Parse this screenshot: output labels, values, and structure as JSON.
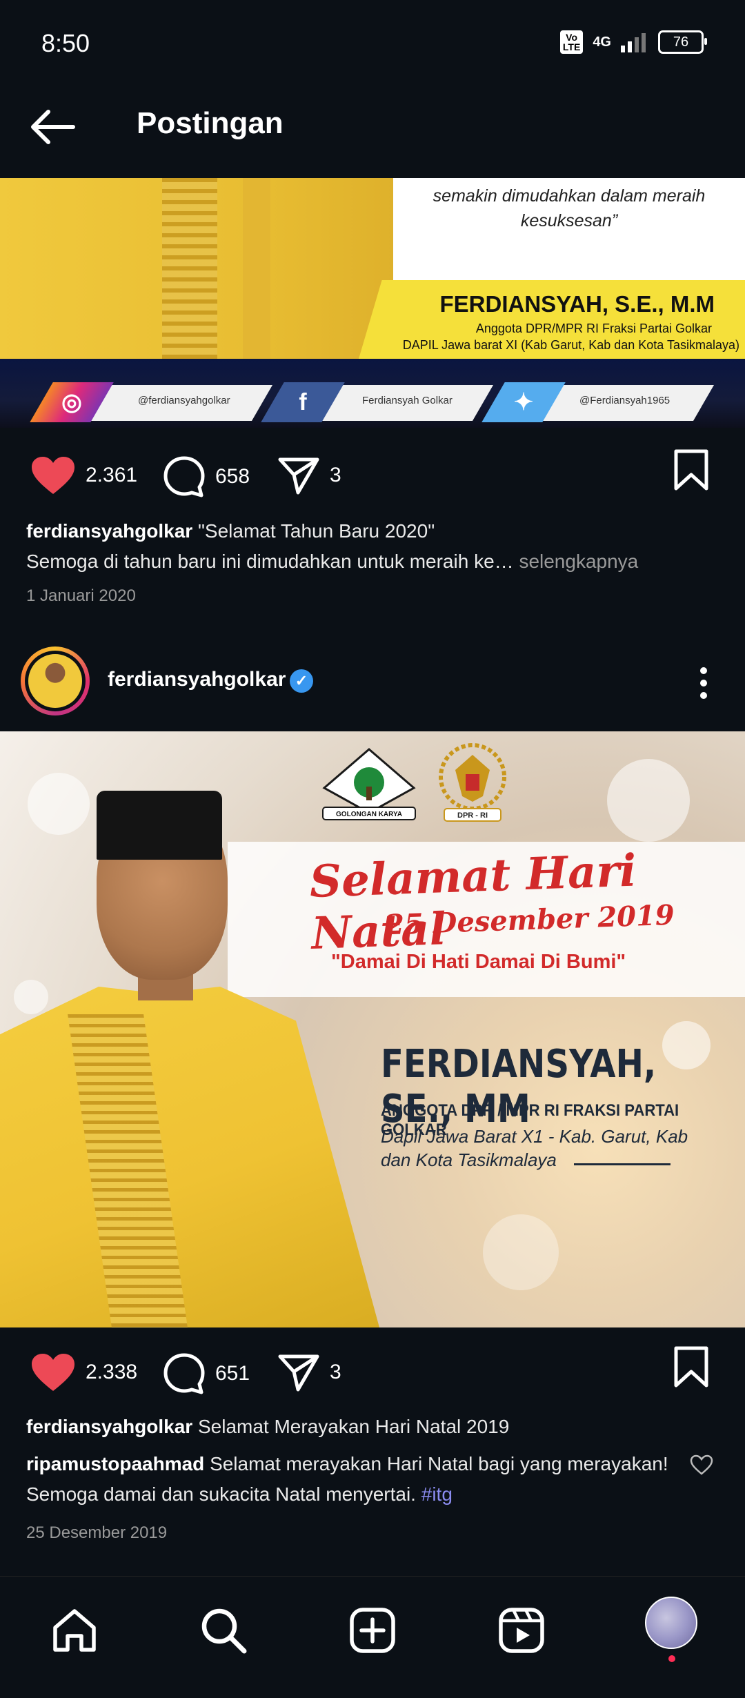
{
  "status_bar": {
    "time": "8:50",
    "volte": "Vo LTE",
    "network": "4G",
    "battery": "76"
  },
  "header": {
    "title": "Postingan"
  },
  "post1": {
    "image": {
      "quote_line1": "semakin dimudahkan dalam meraih",
      "quote_line2": "kesuksesan”",
      "name": "FERDIANSYAH, S.E., M.M",
      "line1": "Anggota DPR/MPR RI Fraksi Partai Golkar",
      "line2": "DAPIL Jawa barat XI (Kab Garut, Kab dan Kota Tasikmalaya)",
      "instagram": "@ferdiansyahgolkar",
      "facebook": "Ferdiansyah Golkar",
      "twitter": "@Ferdiansyah1965"
    },
    "likes": "2.361",
    "comments": "658",
    "shares": "3",
    "caption_user": "ferdiansyahgolkar",
    "caption_text": "\"Selamat Tahun Baru 2020\"",
    "caption_line2": "Semoga di tahun baru ini dimudahkan untuk meraih ke…",
    "more": "selengkapnya",
    "date": "1 Januari 2020"
  },
  "post2": {
    "username": "ferdiansyahgolkar",
    "image": {
      "golkar_logo_text": "GOLONGAN KARYA",
      "dpr_logo_text": "DPR - RI",
      "greeting": "Selamat Hari Natal",
      "greeting_date": "25 Desember 2019",
      "tagline": "\"Damai Di Hati Damai Di Bumi\"",
      "name": "FERDIANSYAH, SE., MM",
      "line1": "ANGGOTA DPR / MPR RI FRAKSI PARTAI GOLKAR",
      "line2": "Dapil Jawa Barat X1 - Kab. Garut, Kab",
      "line3": "dan Kota Tasikmalaya"
    },
    "likes": "2.338",
    "comments": "651",
    "shares": "3",
    "caption_user": "ferdiansyahgolkar",
    "caption_text": "Selamat Merayakan Hari Natal 2019",
    "comment_user": "ripamustopaahmad",
    "comment_text": "Selamat merayakan Hari Natal bagi yang merayakan! Semoga damai dan sukacita Natal menyertai.",
    "hashtag": "#itg",
    "date": "25 Desember 2019"
  },
  "colors": {
    "like_red": "#ed4956",
    "link_blue": "#8b8cf0",
    "verified_blue": "#3897f0"
  },
  "icons": [
    "back-arrow-icon",
    "heart-icon",
    "comment-icon",
    "share-icon",
    "bookmark-icon",
    "more-icon",
    "home-icon",
    "search-icon",
    "add-icon",
    "reels-icon"
  ]
}
